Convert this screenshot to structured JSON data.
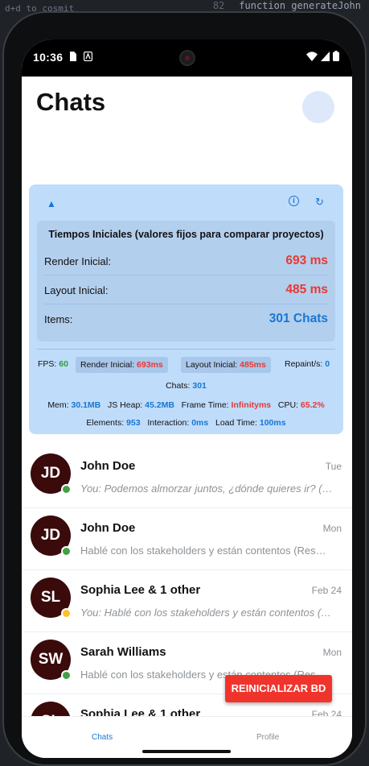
{
  "editor": {
    "left_snippet": "d+d to cosmit",
    "line_number": "82",
    "code_line": "function generateJohn"
  },
  "statusbar": {
    "time": "10:36"
  },
  "header": {
    "title": "Chats"
  },
  "perf": {
    "initial_title": "Tiempos Iniciales (valores fijos para comparar proyectos)",
    "render_label": "Render Inicial:",
    "render_value": "693 ms",
    "layout_label": "Layout Inicial:",
    "layout_value": "485 ms",
    "items_label": "Items:",
    "items_value": "301 Chats",
    "fps_label": "FPS:",
    "fps_value": "60",
    "render_chip_label": "Render Inicial:",
    "render_chip_value": "693ms",
    "layout_chip_label": "Layout Inicial:",
    "layout_chip_value": "485ms",
    "repaint_label": "Repaint/s:",
    "repaint_value": "0",
    "chats_label": "Chats:",
    "chats_value": "301",
    "mem_label": "Mem:",
    "mem_value": "30.1MB",
    "jsheap_label": "JS Heap:",
    "jsheap_value": "45.2MB",
    "frametime_label": "Frame Time:",
    "frametime_value": "Infinityms",
    "cpu_label": "CPU:",
    "cpu_value": "65.2%",
    "elements_label": "Elements:",
    "elements_value": "953",
    "interaction_label": "Interaction:",
    "interaction_value": "0ms",
    "loadtime_label": "Load Time:",
    "loadtime_value": "100ms"
  },
  "chats": [
    {
      "initials": "JD",
      "name": "John Doe",
      "date": "Tue",
      "message": "You: Podemos almorzar juntos, ¿dónde quieres ir? (…",
      "italic": true,
      "status_color": "#43a047"
    },
    {
      "initials": "JD",
      "name": "John Doe",
      "date": "Mon",
      "message": "Hablé con los stakeholders y están contentos (Res…",
      "italic": false,
      "status_color": "#43a047"
    },
    {
      "initials": "SL",
      "name": "Sophia Lee & 1 other",
      "date": "Feb 24",
      "message": "You: Hablé con los stakeholders y están contentos (…",
      "italic": true,
      "status_color": "#fbc02d"
    },
    {
      "initials": "SW",
      "name": "Sarah Williams",
      "date": "Mon",
      "message": "Hablé con los stakeholders y están contentos (Res…",
      "italic": false,
      "status_color": "#43a047"
    },
    {
      "initials": "SL",
      "name": "Sophia Lee & 1 other",
      "date": "Feb 24",
      "message": "",
      "italic": false,
      "status_color": "#43a047"
    }
  ],
  "fab_label": "REINICIALIZAR BD",
  "tabs": {
    "chats": "Chats",
    "profile": "Profile"
  },
  "colors": {
    "accent": "#1976d2",
    "danger": "#e53935",
    "success": "#2e9e35",
    "panel": "#bfdcfb",
    "avatar": "#3b0a0a"
  }
}
